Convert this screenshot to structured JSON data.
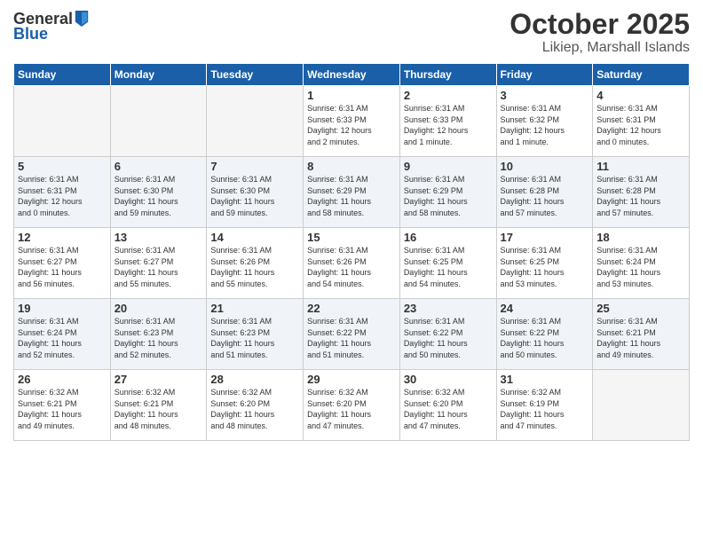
{
  "header": {
    "logo": {
      "general": "General",
      "blue": "Blue"
    },
    "title": "October 2025",
    "location": "Likiep, Marshall Islands"
  },
  "weekdays": [
    "Sunday",
    "Monday",
    "Tuesday",
    "Wednesday",
    "Thursday",
    "Friday",
    "Saturday"
  ],
  "weeks": [
    [
      {
        "day": "",
        "info": ""
      },
      {
        "day": "",
        "info": ""
      },
      {
        "day": "",
        "info": ""
      },
      {
        "day": "1",
        "info": "Sunrise: 6:31 AM\nSunset: 6:33 PM\nDaylight: 12 hours\nand 2 minutes."
      },
      {
        "day": "2",
        "info": "Sunrise: 6:31 AM\nSunset: 6:33 PM\nDaylight: 12 hours\nand 1 minute."
      },
      {
        "day": "3",
        "info": "Sunrise: 6:31 AM\nSunset: 6:32 PM\nDaylight: 12 hours\nand 1 minute."
      },
      {
        "day": "4",
        "info": "Sunrise: 6:31 AM\nSunset: 6:31 PM\nDaylight: 12 hours\nand 0 minutes."
      }
    ],
    [
      {
        "day": "5",
        "info": "Sunrise: 6:31 AM\nSunset: 6:31 PM\nDaylight: 12 hours\nand 0 minutes."
      },
      {
        "day": "6",
        "info": "Sunrise: 6:31 AM\nSunset: 6:30 PM\nDaylight: 11 hours\nand 59 minutes."
      },
      {
        "day": "7",
        "info": "Sunrise: 6:31 AM\nSunset: 6:30 PM\nDaylight: 11 hours\nand 59 minutes."
      },
      {
        "day": "8",
        "info": "Sunrise: 6:31 AM\nSunset: 6:29 PM\nDaylight: 11 hours\nand 58 minutes."
      },
      {
        "day": "9",
        "info": "Sunrise: 6:31 AM\nSunset: 6:29 PM\nDaylight: 11 hours\nand 58 minutes."
      },
      {
        "day": "10",
        "info": "Sunrise: 6:31 AM\nSunset: 6:28 PM\nDaylight: 11 hours\nand 57 minutes."
      },
      {
        "day": "11",
        "info": "Sunrise: 6:31 AM\nSunset: 6:28 PM\nDaylight: 11 hours\nand 57 minutes."
      }
    ],
    [
      {
        "day": "12",
        "info": "Sunrise: 6:31 AM\nSunset: 6:27 PM\nDaylight: 11 hours\nand 56 minutes."
      },
      {
        "day": "13",
        "info": "Sunrise: 6:31 AM\nSunset: 6:27 PM\nDaylight: 11 hours\nand 55 minutes."
      },
      {
        "day": "14",
        "info": "Sunrise: 6:31 AM\nSunset: 6:26 PM\nDaylight: 11 hours\nand 55 minutes."
      },
      {
        "day": "15",
        "info": "Sunrise: 6:31 AM\nSunset: 6:26 PM\nDaylight: 11 hours\nand 54 minutes."
      },
      {
        "day": "16",
        "info": "Sunrise: 6:31 AM\nSunset: 6:25 PM\nDaylight: 11 hours\nand 54 minutes."
      },
      {
        "day": "17",
        "info": "Sunrise: 6:31 AM\nSunset: 6:25 PM\nDaylight: 11 hours\nand 53 minutes."
      },
      {
        "day": "18",
        "info": "Sunrise: 6:31 AM\nSunset: 6:24 PM\nDaylight: 11 hours\nand 53 minutes."
      }
    ],
    [
      {
        "day": "19",
        "info": "Sunrise: 6:31 AM\nSunset: 6:24 PM\nDaylight: 11 hours\nand 52 minutes."
      },
      {
        "day": "20",
        "info": "Sunrise: 6:31 AM\nSunset: 6:23 PM\nDaylight: 11 hours\nand 52 minutes."
      },
      {
        "day": "21",
        "info": "Sunrise: 6:31 AM\nSunset: 6:23 PM\nDaylight: 11 hours\nand 51 minutes."
      },
      {
        "day": "22",
        "info": "Sunrise: 6:31 AM\nSunset: 6:22 PM\nDaylight: 11 hours\nand 51 minutes."
      },
      {
        "day": "23",
        "info": "Sunrise: 6:31 AM\nSunset: 6:22 PM\nDaylight: 11 hours\nand 50 minutes."
      },
      {
        "day": "24",
        "info": "Sunrise: 6:31 AM\nSunset: 6:22 PM\nDaylight: 11 hours\nand 50 minutes."
      },
      {
        "day": "25",
        "info": "Sunrise: 6:31 AM\nSunset: 6:21 PM\nDaylight: 11 hours\nand 49 minutes."
      }
    ],
    [
      {
        "day": "26",
        "info": "Sunrise: 6:32 AM\nSunset: 6:21 PM\nDaylight: 11 hours\nand 49 minutes."
      },
      {
        "day": "27",
        "info": "Sunrise: 6:32 AM\nSunset: 6:21 PM\nDaylight: 11 hours\nand 48 minutes."
      },
      {
        "day": "28",
        "info": "Sunrise: 6:32 AM\nSunset: 6:20 PM\nDaylight: 11 hours\nand 48 minutes."
      },
      {
        "day": "29",
        "info": "Sunrise: 6:32 AM\nSunset: 6:20 PM\nDaylight: 11 hours\nand 47 minutes."
      },
      {
        "day": "30",
        "info": "Sunrise: 6:32 AM\nSunset: 6:20 PM\nDaylight: 11 hours\nand 47 minutes."
      },
      {
        "day": "31",
        "info": "Sunrise: 6:32 AM\nSunset: 6:19 PM\nDaylight: 11 hours\nand 47 minutes."
      },
      {
        "day": "",
        "info": ""
      }
    ]
  ]
}
